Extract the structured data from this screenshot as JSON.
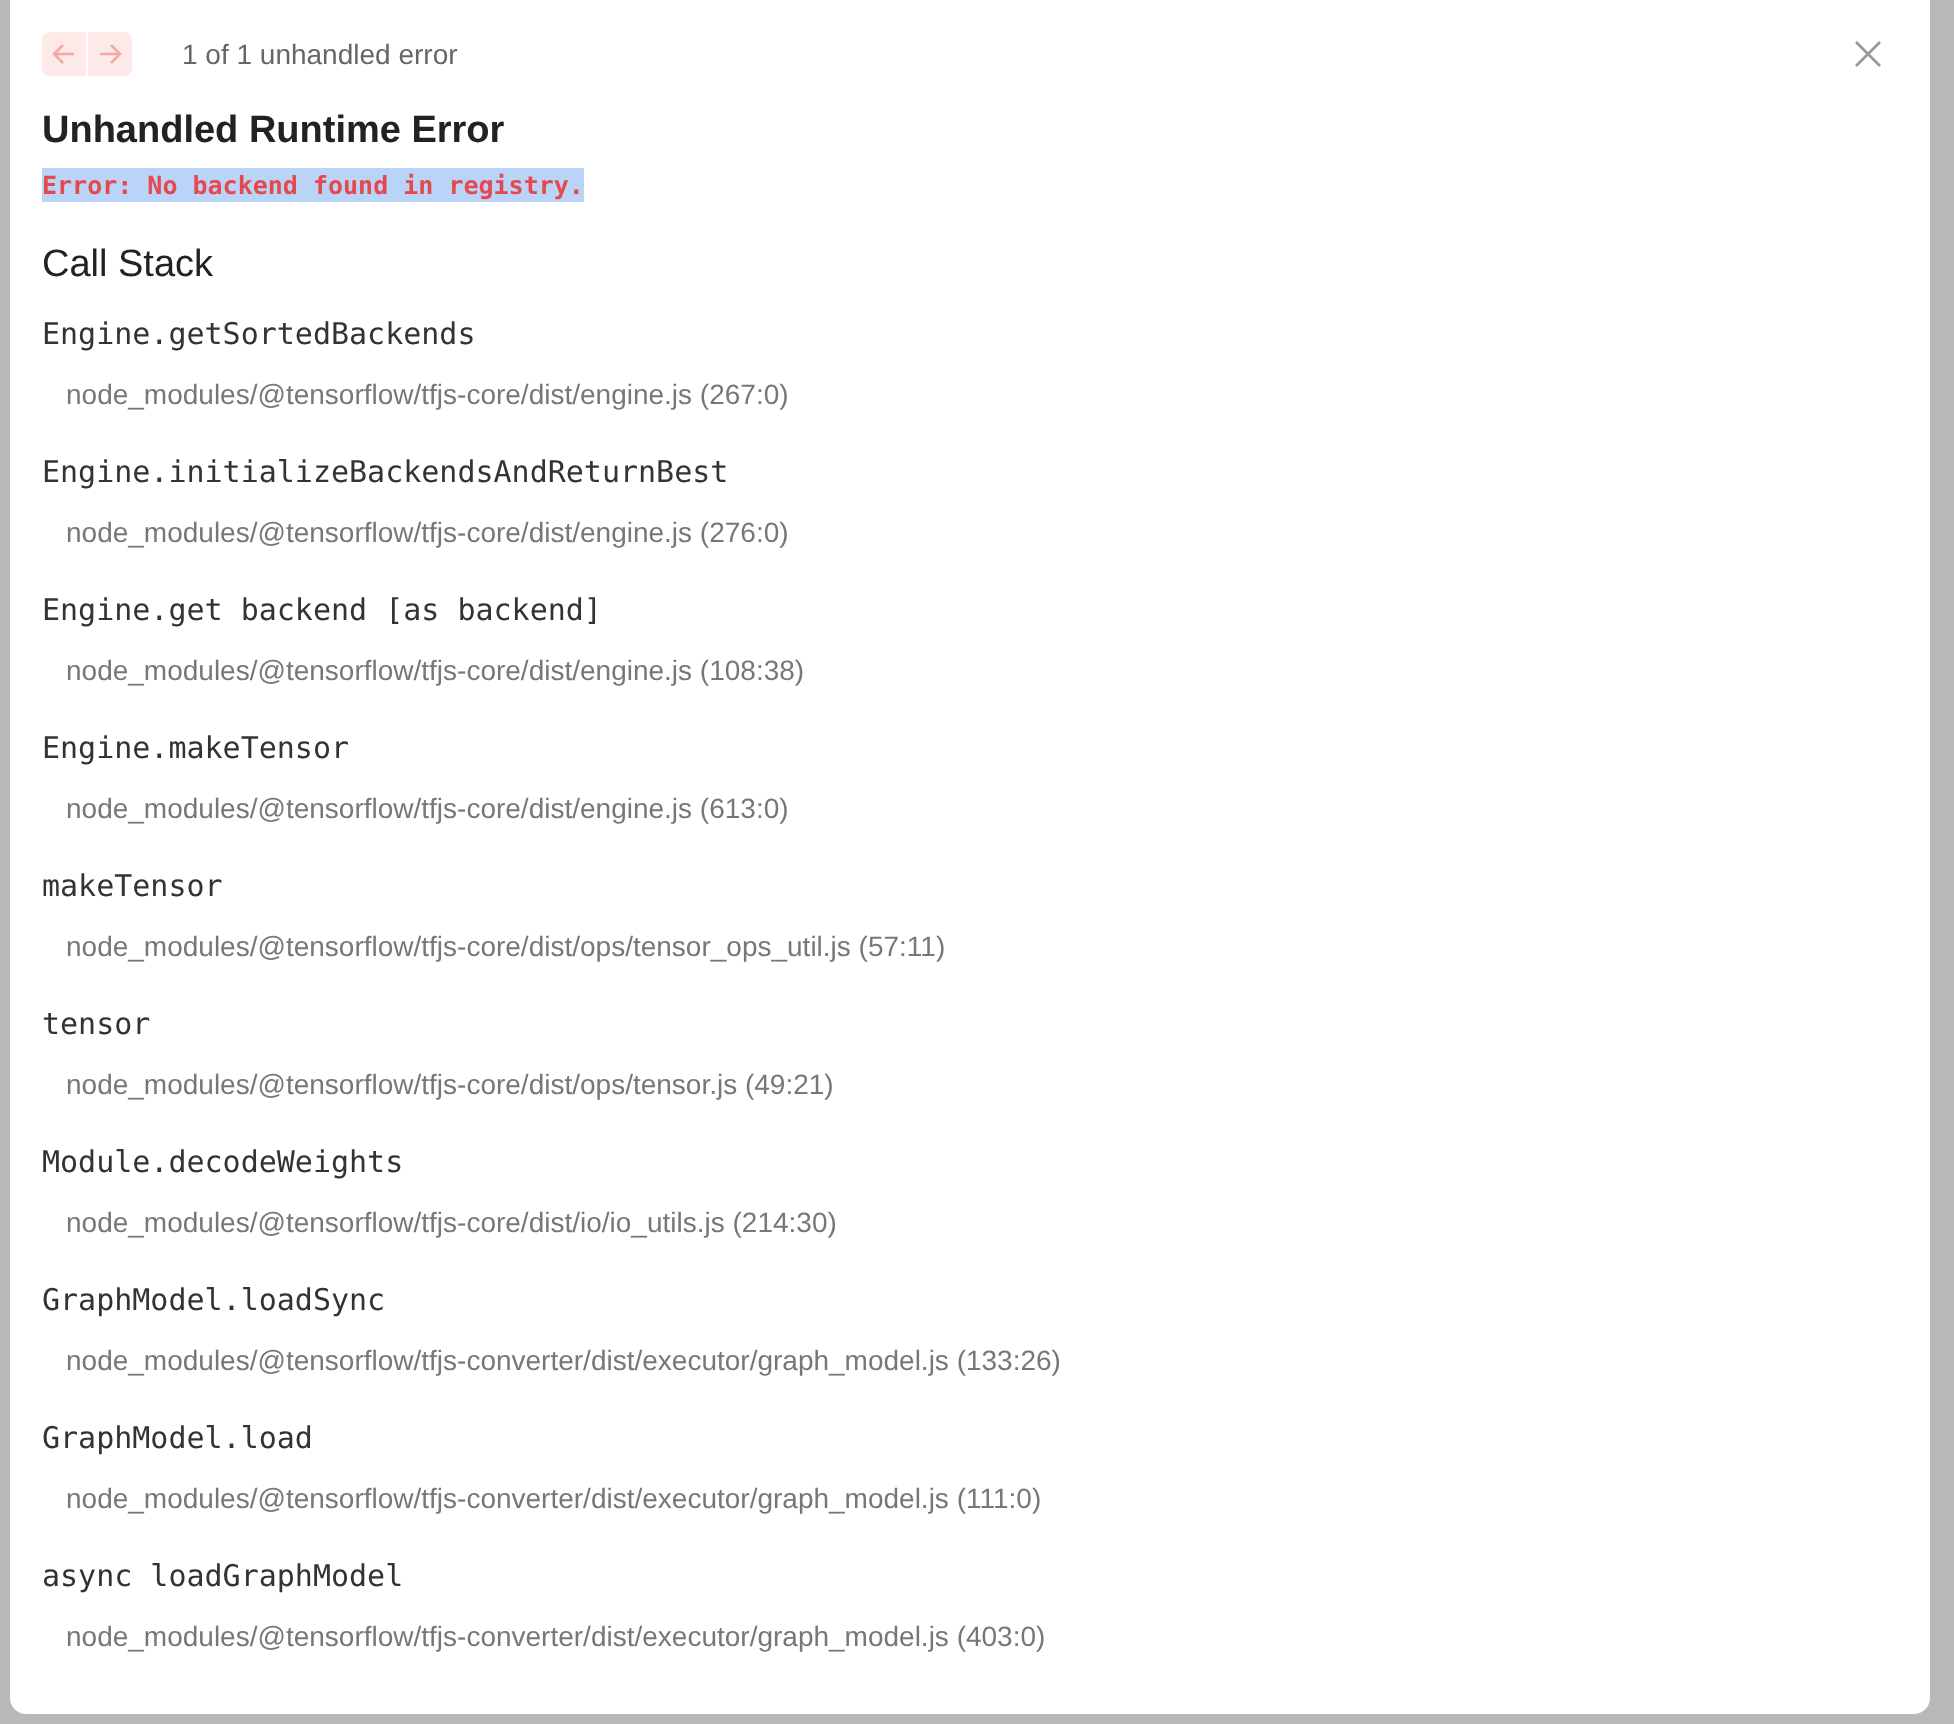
{
  "pagination": {
    "prev_disabled": true,
    "next_disabled": true,
    "count": "1 of 1 unhandled error"
  },
  "title": "Unhandled Runtime Error",
  "error_message": "Error: No backend found in registry.",
  "call_stack": {
    "heading": "Call Stack",
    "frames": [
      {
        "function": "Engine.getSortedBackends",
        "location": "node_modules/@tensorflow/tfjs-core/dist/engine.js (267:0)"
      },
      {
        "function": "Engine.initializeBackendsAndReturnBest",
        "location": "node_modules/@tensorflow/tfjs-core/dist/engine.js (276:0)"
      },
      {
        "function": "Engine.get backend [as backend]",
        "location": "node_modules/@tensorflow/tfjs-core/dist/engine.js (108:38)"
      },
      {
        "function": "Engine.makeTensor",
        "location": "node_modules/@tensorflow/tfjs-core/dist/engine.js (613:0)"
      },
      {
        "function": "makeTensor",
        "location": "node_modules/@tensorflow/tfjs-core/dist/ops/tensor_ops_util.js (57:11)"
      },
      {
        "function": "tensor",
        "location": "node_modules/@tensorflow/tfjs-core/dist/ops/tensor.js (49:21)"
      },
      {
        "function": "Module.decodeWeights",
        "location": "node_modules/@tensorflow/tfjs-core/dist/io/io_utils.js (214:30)"
      },
      {
        "function": "GraphModel.loadSync",
        "location": "node_modules/@tensorflow/tfjs-converter/dist/executor/graph_model.js (133:26)"
      },
      {
        "function": "GraphModel.load",
        "location": "node_modules/@tensorflow/tfjs-converter/dist/executor/graph_model.js (111:0)"
      },
      {
        "function": "async loadGraphModel",
        "location": "node_modules/@tensorflow/tfjs-converter/dist/executor/graph_model.js (403:0)"
      }
    ]
  }
}
